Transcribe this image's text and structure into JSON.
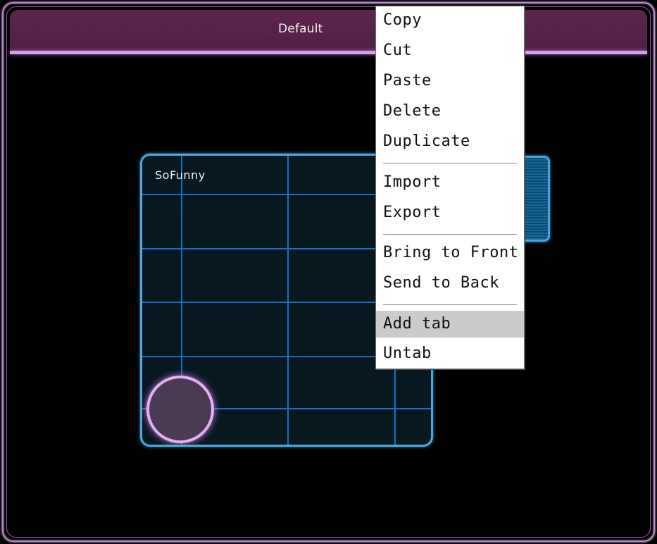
{
  "window": {
    "title": "Default"
  },
  "panel": {
    "label": "SoFunny"
  },
  "context_menu": {
    "items": [
      {
        "label": "Copy"
      },
      {
        "label": "Cut"
      },
      {
        "label": "Paste"
      },
      {
        "label": "Delete"
      },
      {
        "label": "Duplicate"
      },
      {
        "label": "Import"
      },
      {
        "label": "Export"
      },
      {
        "label": "Bring to Front"
      },
      {
        "label": "Send to Back"
      },
      {
        "label": "Add tab"
      },
      {
        "label": "Untab"
      }
    ],
    "highlighted_item": "Add tab"
  },
  "colors": {
    "title_bar": "#5d2550",
    "title_line": "#d2a3df",
    "panel_border": "#4fa7dd",
    "grid_line": "#1f72d3",
    "knob_ring": "#e5b0ef",
    "menu_highlight": "#cbcbcb"
  }
}
